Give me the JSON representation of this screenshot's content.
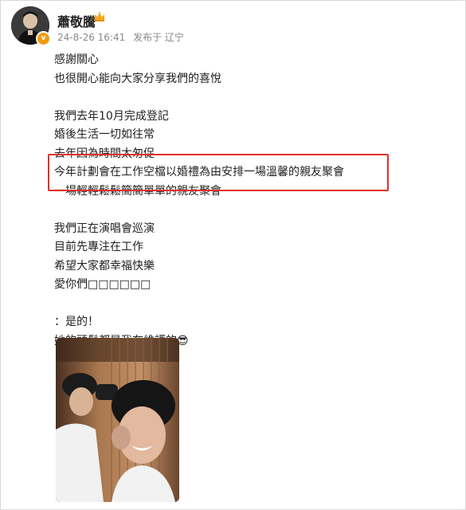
{
  "post": {
    "author": "蕭敬騰",
    "timestamp": "24-8-26 16:41",
    "source": "发布于 辽宁",
    "lines": [
      "感謝關心",
      "也很開心能向大家分享我們的喜悅",
      "",
      "我們去年10月完成登記",
      "婚後生活一切如往常",
      "去年因為時間太匆促",
      "今年計劃會在工作空檔以婚禮為由安排一場溫馨的親友聚會",
      "一場輕輕鬆鬆簡簡單單的親友聚會",
      "",
      "我們正在演唱會巡演",
      "目前先專注在工作",
      "希望大家都幸福快樂",
      "愛你們□□□□□□",
      "",
      "：是的！",
      "她的頭髮都是我在維護的😎"
    ]
  },
  "icons": {
    "verified": "verified-v-badge-icon",
    "crown": "crown-icon",
    "avatar": "avatar-image"
  },
  "colors": {
    "highlight_border": "#e0302e",
    "meta_text": "#8a8a8a",
    "badge": "#f39c12"
  }
}
